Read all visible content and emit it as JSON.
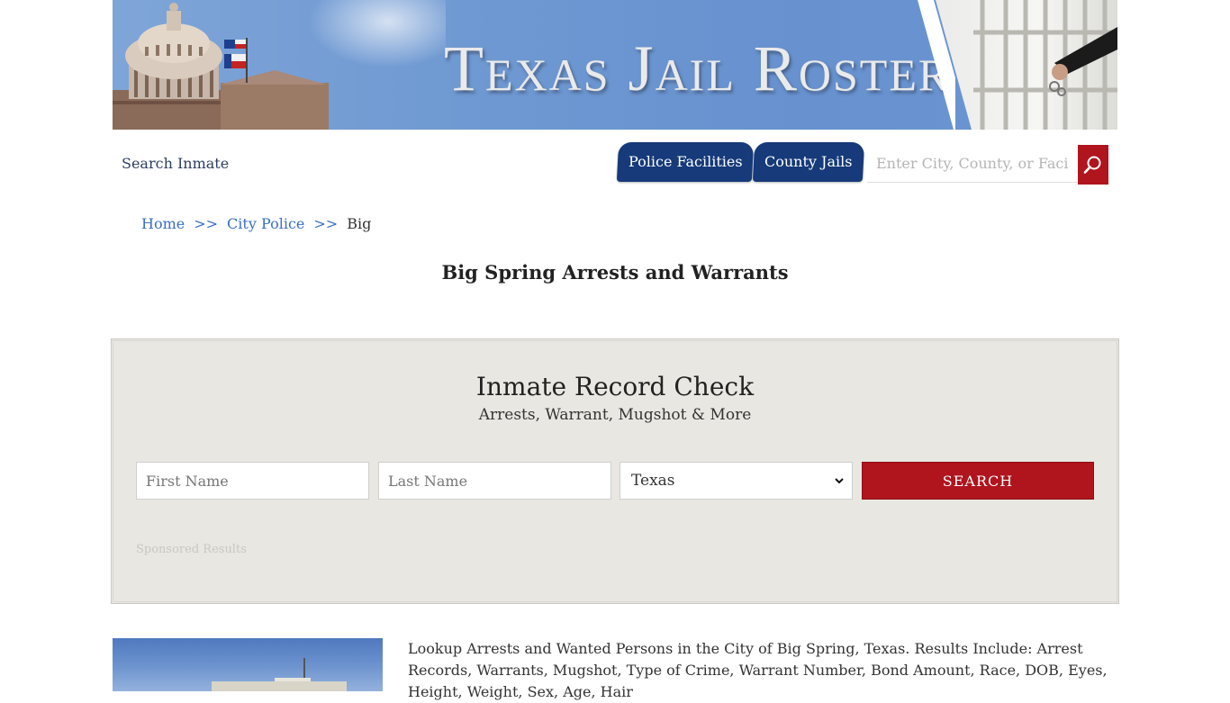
{
  "banner": {
    "title": "Texas Jail Roster"
  },
  "nav": {
    "search_inmate": "Search Inmate",
    "tabs": [
      {
        "label": "Police Facilities"
      },
      {
        "label": "County Jails"
      }
    ],
    "facility_search_placeholder": "Enter City, County, or Facility"
  },
  "breadcrumb": {
    "home": "Home",
    "separator": ">>",
    "section": "City Police",
    "current": "Big"
  },
  "page_title": "Big Spring Arrests and Warrants",
  "record_check": {
    "title": "Inmate Record Check",
    "subtitle": "Arrests, Warrant, Mugshot & More",
    "first_name_placeholder": "First Name",
    "last_name_placeholder": "Last Name",
    "state_selected": "Texas",
    "search_label": "SEARCH",
    "sponsored": "Sponsored Results"
  },
  "intro": {
    "text": "Lookup Arrests and Wanted Persons in the City of Big Spring, Texas. Results Include: Arrest Records, Warrants, Mugshot, Type of Crime, Warrant Number, Bond Amount, Race, DOB, Eyes, Height, Weight, Sex, Age, Hair"
  },
  "colors": {
    "brand_blue": "#163a7a",
    "accent_red": "#b0141d",
    "link_blue": "#3a6fc4",
    "panel_bg": "#e9e7e2"
  },
  "icons": {
    "search": "magnifier-icon",
    "dropdown": "chevron-down-icon"
  }
}
